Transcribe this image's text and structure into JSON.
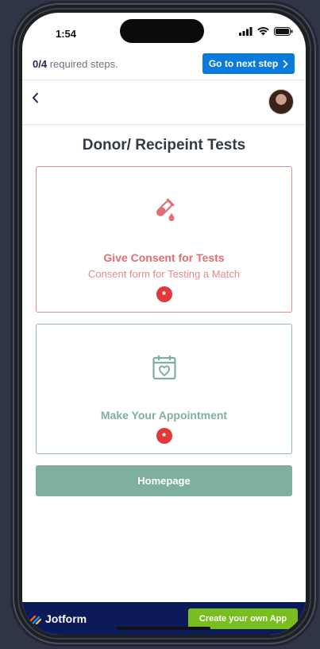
{
  "status_bar": {
    "time": "1:54"
  },
  "progress": {
    "completed": "0/4",
    "label": "required steps.",
    "next_button": "Go to next step"
  },
  "page": {
    "title": "Donor/ Recipeint Tests"
  },
  "cards": [
    {
      "title": "Give Consent for Tests",
      "subtitle": "Consent form for Testing a Match",
      "required_mark": "*",
      "icon": "test-tube-drop-icon",
      "color": "#e06e72"
    },
    {
      "title": "Make Your Appointment",
      "required_mark": "*",
      "icon": "calendar-heart-icon",
      "color": "#7faf9f"
    }
  ],
  "home_button": {
    "label": "Homepage"
  },
  "footer": {
    "brand": "Jotform",
    "cta": "Create your own App"
  },
  "colors": {
    "primary_blue": "#0a7bdc",
    "footer_navy": "#0d1a59",
    "cta_green": "#78be20",
    "required_red": "#e0393b"
  }
}
